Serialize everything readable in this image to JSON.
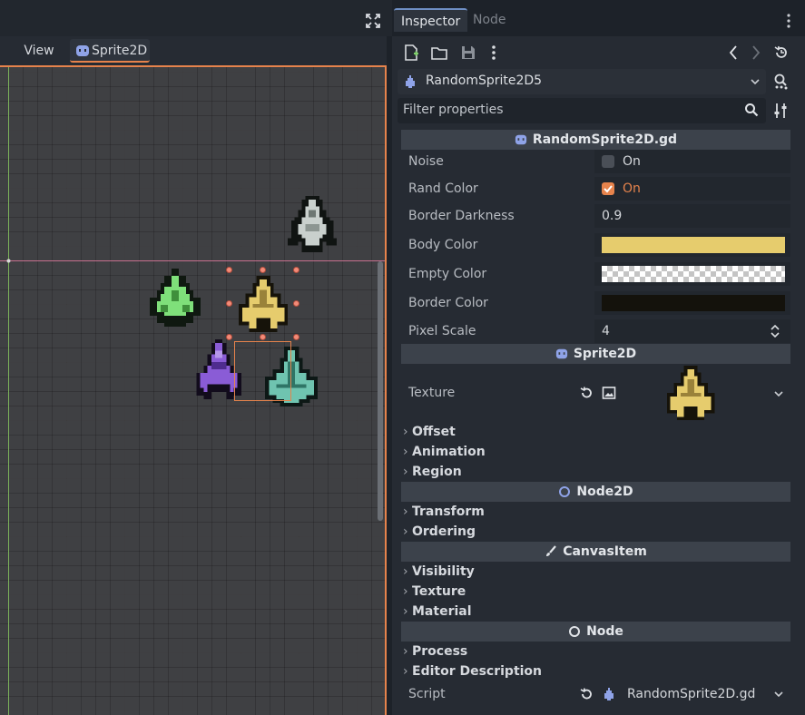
{
  "viewport_toolbar": {
    "view_label": "View",
    "tab_label": "Sprite2D"
  },
  "inspector": {
    "tabs": [
      {
        "label": "Inspector"
      },
      {
        "label": "Node"
      }
    ],
    "object_name": "RandomSprite2D5",
    "filter_placeholder": "Filter properties",
    "sections": {
      "script": "RandomSprite2D.gd",
      "sprite": "Sprite2D",
      "node2d": "Node2D",
      "canvasitem": "CanvasItem",
      "node": "Node"
    },
    "props": {
      "noise": {
        "label": "Noise",
        "checked": false,
        "value_label": "On"
      },
      "rand_color": {
        "label": "Rand Color",
        "checked": true,
        "value_label": "On"
      },
      "border_darkness": {
        "label": "Border Darkness",
        "value": "0.9"
      },
      "body_color": {
        "label": "Body Color",
        "color": "#e6cc6d"
      },
      "empty_color": {
        "label": "Empty Color",
        "color": "transparent"
      },
      "border_color": {
        "label": "Border Color",
        "color": "#14120c"
      },
      "pixel_scale": {
        "label": "Pixel Scale",
        "value": "4"
      },
      "texture": {
        "label": "Texture"
      },
      "script": {
        "label": "Script",
        "value": "RandomSprite2D.gd"
      }
    },
    "categories": {
      "offset": "Offset",
      "animation": "Animation",
      "region": "Region",
      "transform": "Transform",
      "ordering": "Ordering",
      "visibility": "Visibility",
      "texture": "Texture",
      "material": "Material",
      "process": "Process",
      "editor_description": "Editor Description"
    }
  },
  "colors": {
    "accent": "#e6834c",
    "ship_gray": "#c9d0cd",
    "ship_green": "#7fe07a",
    "ship_yellow": "#e6cc6d",
    "ship_purple": "#8a5cd6",
    "ship_teal": "#6fc4b0"
  },
  "icons": {
    "fullscreen": "fullscreen-icon",
    "new_script": "new-resource-icon",
    "open": "folder-icon",
    "save": "save-icon",
    "menu": "kebab-icon",
    "back": "chevron-left-icon",
    "forward": "chevron-right-icon",
    "history": "history-icon",
    "search": "search-icon",
    "tools": "tools-icon"
  }
}
